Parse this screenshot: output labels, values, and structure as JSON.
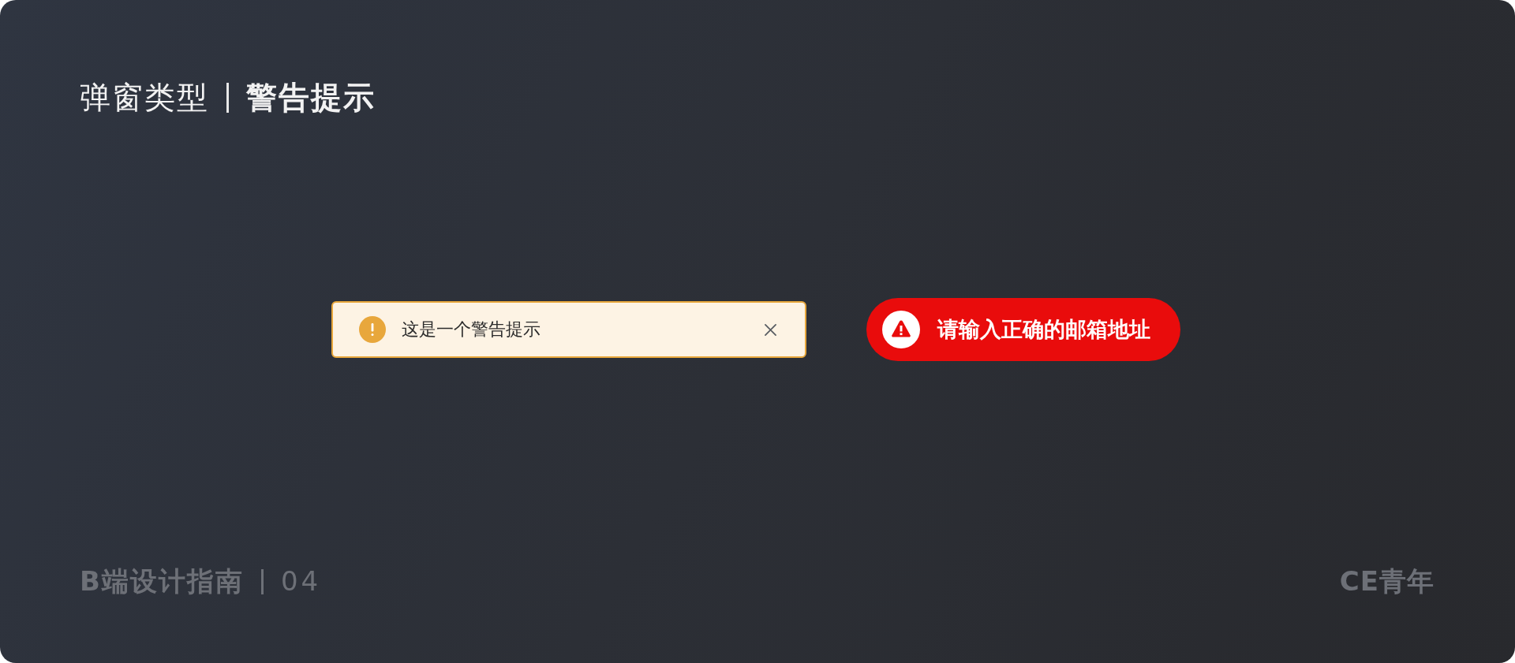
{
  "header": {
    "category": "弹窗类型",
    "title": "警告提示"
  },
  "alerts": [
    {
      "kind": "banner",
      "message": "这是一个警告提示",
      "closable": true
    },
    {
      "kind": "toast",
      "message": "请输入正确的邮箱地址"
    }
  ],
  "footer": {
    "series": "B端设计指南",
    "page": "04",
    "brand": "CE青年"
  }
}
